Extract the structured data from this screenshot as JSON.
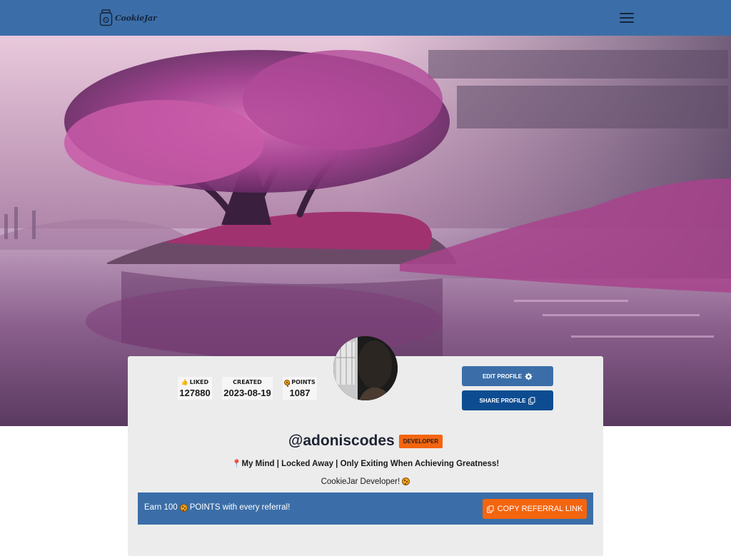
{
  "navbar": {
    "brand_name": "CookieJar",
    "brand_icon": "cookie-jar-icon",
    "menu_icon": "hamburger-icon",
    "background_color": "#3b6ea8"
  },
  "profile": {
    "stats": [
      {
        "label": "LIKED",
        "value": "127880",
        "icon": "thumbs-up-icon"
      },
      {
        "label": "CREATED",
        "value": "2023-08-19"
      },
      {
        "label": "POINTS",
        "value": "1087",
        "icon": "cookie-icon"
      }
    ],
    "edit_button_label": "EDIT PROFILE",
    "edit_button_icon": "gear-icon",
    "share_button_label": "SHARE PROFILE",
    "share_button_icon": "copy-icon",
    "username": "@adoniscodes",
    "badge": "DEVELOPER",
    "bio_text": "My Mind | Locked Away | Only Exiting When Achieving Greatness!",
    "bio_icon": "pin-icon",
    "tagline_text": "CookieJar Developer!",
    "tagline_icon": "cookie-icon"
  },
  "referral": {
    "text_before": "Earn 100",
    "icon": "cookie-icon",
    "text_after": "POINTS with every referral!",
    "button_label": "COPY REFERRAL LINK",
    "button_icon": "copy-icon",
    "accent_color": "#f4650f"
  }
}
